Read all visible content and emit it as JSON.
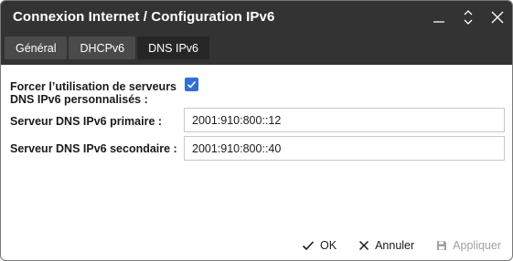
{
  "window": {
    "title": "Connexion Internet / Configuration IPv6"
  },
  "tabs": [
    {
      "label": "Général",
      "active": false
    },
    {
      "label": "DHCPv6",
      "active": false
    },
    {
      "label": "DNS IPv6",
      "active": true
    }
  ],
  "form": {
    "force_label_line1": "Forcer l’utilisation de serveurs",
    "force_label_line2": "DNS IPv6 personnalisés :",
    "force_checked": true,
    "primary_label": "Serveur DNS IPv6 primaire :",
    "primary_value": "2001:910:800::12",
    "secondary_label": "Serveur DNS IPv6 secondaire :",
    "secondary_value": "2001:910:800::40"
  },
  "footer": {
    "ok_label": "OK",
    "cancel_label": "Annuler",
    "apply_label": "Appliquer"
  },
  "icons": {
    "minimize": "minimize-icon",
    "expand": "expand-collapse-icon",
    "close": "close-icon",
    "check": "check-icon",
    "cancel": "x-icon",
    "save": "floppy-disk-icon"
  },
  "colors": {
    "titlebar": "#333333",
    "tab": "#4a4a4a",
    "tab_active": "#262626",
    "checkbox": "#2f6fd6",
    "disabled_text": "#a0a0a0"
  }
}
